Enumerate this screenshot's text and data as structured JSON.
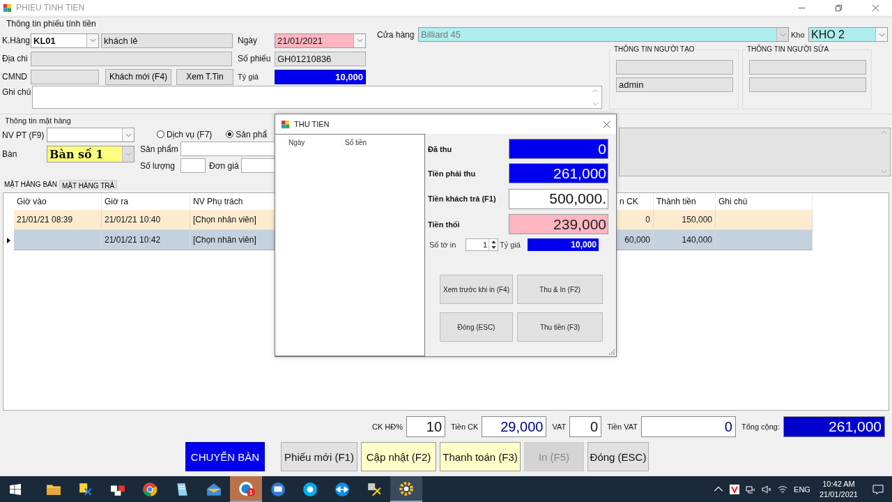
{
  "window": {
    "title": "PHIEU TINH TIEN"
  },
  "invoice_info": {
    "legend": "Thông tin phiếu tính tiền",
    "customer": {
      "label": "K.Hàng",
      "code": "KL01",
      "name": "khách lẻ"
    },
    "address": {
      "label": "Địa chi"
    },
    "id_card": {
      "label": "CMND"
    },
    "buttons": [
      "Khách mới (F4)",
      "Xem T.Tin"
    ],
    "note": {
      "label": "Ghi chú"
    },
    "date": {
      "label": "Ngày",
      "value": "21/01/2021"
    },
    "receipt_no": {
      "label": "Số phiếu",
      "value": "GH01210836"
    },
    "rate": {
      "label": "Tý giá",
      "value": "10,000"
    },
    "store": {
      "label": "Cửa hàng",
      "value": "Billiard 45"
    },
    "warehouse": {
      "label": "Kho",
      "value": "KHO 2"
    },
    "creator": {
      "legend": "THÔNG TIN NGƯỜI TẠO",
      "user": "admin"
    },
    "editor": {
      "legend": "THÔNG TIN NGƯỜI SỬA"
    }
  },
  "item_info": {
    "legend": "Thông tin mặt hàng",
    "staff_label": "NV PT (F9)",
    "table_label": "Bàn",
    "table_value": "Bàn số 1",
    "radios": [
      {
        "label": "Dịch vụ (F7)",
        "selected": false
      },
      {
        "label": "Sản phẩ",
        "selected": true
      }
    ],
    "product_label": "Sản phẩm",
    "qty_label": "Số lượng",
    "price_label": "Đơn giá"
  },
  "tabs": [
    {
      "label": "MẶT HÀNG BÁN",
      "selected": true
    },
    {
      "label": "MẶT HÀNG TRẢ",
      "selected": false
    }
  ],
  "grid": {
    "columns": [
      "Giờ vào",
      "Giờ ra",
      "NV Phụ trách",
      "n CK",
      "Thành tiền",
      "Ghi chú"
    ],
    "rows": [
      {
        "selected": false,
        "time_in": "21/01/21 08:39",
        "time_out": "21/01/21 10:40",
        "staff": "[Chọn nhân viên]",
        "discount": "0",
        "amount": "150,000"
      },
      {
        "selected": true,
        "time_out": "21/01/21 10:42",
        "staff": "[Chọn nhân viên]",
        "discount": "60,000",
        "amount": "140,000"
      }
    ]
  },
  "totals": [
    {
      "label": "CK HĐ%",
      "value": "10",
      "kind": "input"
    },
    {
      "label": "Tiền CK",
      "value": "29,000",
      "kind": "amount"
    },
    {
      "label": "VAT",
      "value": "0",
      "kind": "input"
    },
    {
      "label": "Tiền VAT",
      "value": "0",
      "kind": "amount"
    },
    {
      "label": "Tổng cộng:",
      "value": "261,000",
      "kind": "total"
    }
  ],
  "actions": [
    {
      "label": "CHUYỂN BÀN",
      "kind": "primary",
      "disabled": false
    },
    {
      "label": "Phiếu mới (F1)",
      "kind": "normal",
      "disabled": false
    },
    {
      "label": "Cập nhật (F2)",
      "kind": "highlight",
      "disabled": false
    },
    {
      "label": "Thanh toán (F3)",
      "kind": "highlight",
      "disabled": false
    },
    {
      "label": "In (F5)",
      "kind": "normal",
      "disabled": true
    },
    {
      "label": "Đóng (ESC)",
      "kind": "normal",
      "disabled": false
    }
  ],
  "dialog": {
    "title": "THU TIEN",
    "columns": [
      "Ngày",
      "Số tiền"
    ],
    "amounts": [
      {
        "label": "Đã thu",
        "value": "0",
        "kind": "blue"
      },
      {
        "label": "Tiền phải thu",
        "value": "261,000",
        "kind": "blue"
      },
      {
        "label": "Tiền khách trả (F1)",
        "value": "500,000.",
        "kind": "input"
      },
      {
        "label": "Tiền thối",
        "value": "239,000",
        "kind": "pink"
      }
    ],
    "copies": {
      "label": "Số tờ in",
      "value": "1"
    },
    "rate": {
      "label": "Tỷ giá",
      "value": "10,000"
    },
    "buttons": [
      "Xem trước khi in (F4)",
      "Thu & In (F2)",
      "Đóng (ESC)",
      "Thu tiền (F3)"
    ]
  },
  "taskbar": {
    "apps": [
      {
        "active": false
      },
      {
        "active": false
      },
      {
        "active": false
      },
      {
        "active": false
      },
      {
        "active": false
      },
      {
        "active": false
      },
      {
        "active": true,
        "badge": "1"
      },
      {
        "active": false
      },
      {
        "active": false
      },
      {
        "active": false
      },
      {
        "active": false
      },
      {
        "active": true
      }
    ],
    "language": "ENG",
    "time": "10:42 AM",
    "date": "21/01/2021"
  }
}
